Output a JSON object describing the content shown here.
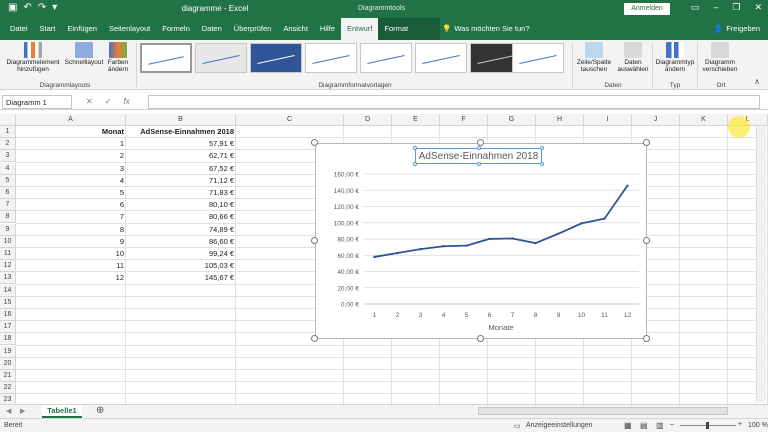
{
  "titlebar": {
    "title": "diagramme  -  Excel",
    "context_label": "Diagrammtools",
    "login_label": "Anmelden"
  },
  "tabs": [
    "Datei",
    "Start",
    "Einfügen",
    "Seitenlayout",
    "Formeln",
    "Daten",
    "Überprüfen",
    "Ansicht",
    "Hilfe",
    "Entwurf",
    "Format"
  ],
  "active_tab": "Entwurf",
  "tell_me": "Was möchten Sie tun?",
  "share_label": "Freigeben",
  "ribbon": {
    "add_element": "Diagrammelement hinzufügen",
    "quick_layout": "Schnelllayout",
    "colors": "Farben ändern",
    "layouts_group": "Diagrammlayouts",
    "styles_group": "Diagrammformatvorlagen",
    "switch_rowcol": "Zeile/Spalte tauschen",
    "select_data": "Daten auswählen",
    "data_group": "Daten",
    "change_type": "Diagrammtyp ändern",
    "type_group": "Typ",
    "move_chart": "Diagramm verschieben",
    "location_group": "Ort"
  },
  "namebox": "Diagramm 1",
  "columns": [
    "A",
    "B",
    "C",
    "D",
    "E",
    "F",
    "G",
    "H",
    "I",
    "J",
    "K",
    "L"
  ],
  "rows": [
    "1",
    "2",
    "3",
    "4",
    "5",
    "6",
    "7",
    "8",
    "9",
    "10",
    "11",
    "12",
    "13",
    "14",
    "15",
    "16",
    "17",
    "18",
    "19",
    "20",
    "21",
    "22",
    "23"
  ],
  "table": {
    "header": [
      "Monat",
      "AdSense-Einnahmen 2018"
    ],
    "rows": [
      [
        "1",
        "57,91 €"
      ],
      [
        "2",
        "62,71 €"
      ],
      [
        "3",
        "67,52 €"
      ],
      [
        "4",
        "71,12 €"
      ],
      [
        "5",
        "71,83 €"
      ],
      [
        "6",
        "80,10 €"
      ],
      [
        "7",
        "80,66 €"
      ],
      [
        "8",
        "74,89 €"
      ],
      [
        "9",
        "86,60 €"
      ],
      [
        "10",
        "99,24 €"
      ],
      [
        "11",
        "105,03 €"
      ],
      [
        "12",
        "145,67 €"
      ]
    ]
  },
  "chart_data": {
    "type": "line",
    "title": "AdSense-Einnahmen 2018",
    "xlabel": "Monate",
    "ylabel": "",
    "categories": [
      "1",
      "2",
      "3",
      "4",
      "5",
      "6",
      "7",
      "8",
      "9",
      "10",
      "11",
      "12"
    ],
    "values": [
      57.91,
      62.71,
      67.52,
      71.12,
      71.83,
      80.1,
      80.66,
      74.89,
      86.6,
      99.24,
      105.03,
      145.67
    ],
    "ylim": [
      0,
      160
    ],
    "yticks": [
      "0,00 €",
      "20,00 €",
      "40,00 €",
      "60,00 €",
      "80,00 €",
      "100,00 €",
      "120,00 €",
      "140,00 €",
      "160,00 €"
    ],
    "line_color": "#2f5597",
    "grid": true
  },
  "sheet_tab": "Tabelle1",
  "status": {
    "ready": "Bereit",
    "display_settings": "Anzeigeeinstellungen",
    "zoom": "100 %"
  },
  "colors": {
    "accent": "#217346"
  }
}
